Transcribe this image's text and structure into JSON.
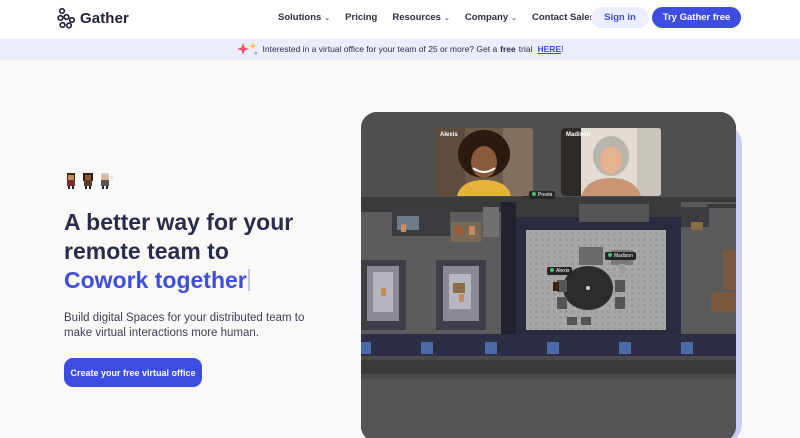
{
  "nav": {
    "brand": "Gather",
    "menu": [
      {
        "label": "Solutions",
        "dropdown": true
      },
      {
        "label": "Pricing",
        "dropdown": false
      },
      {
        "label": "Resources",
        "dropdown": true
      },
      {
        "label": "Company",
        "dropdown": true
      },
      {
        "label": "Contact Sales",
        "dropdown": false
      }
    ],
    "sign_in": "Sign in",
    "try_free": "Try Gather free"
  },
  "banner": {
    "text_before": "Interested in a virtual office for your team of 25 or more? Get a",
    "text_bold": "free",
    "text_after": "trial",
    "link": "HERE",
    "text_end": "!"
  },
  "hero": {
    "title_line1": "A better way for your",
    "title_line2": "remote team to",
    "title_highlight": "Cowork together",
    "subtitle": "Build digital Spaces for your distributed team to make virtual interactions more human.",
    "cta": "Create your free virtual office"
  },
  "game": {
    "video_1_name": "Alexis",
    "video_2_name": "Madison",
    "tag_1": "Presta",
    "tag_2": "Alexis",
    "tag_3": "Madison"
  },
  "colors": {
    "accent": "#3c4de0",
    "banner_bg": "#ebedfc",
    "page_bg": "#fbf9f8",
    "game_bg": "#525252"
  },
  "icons": [
    "gather-logo-icon",
    "chevron-down-icon",
    "sparkle-icon",
    "avatar-icons"
  ]
}
